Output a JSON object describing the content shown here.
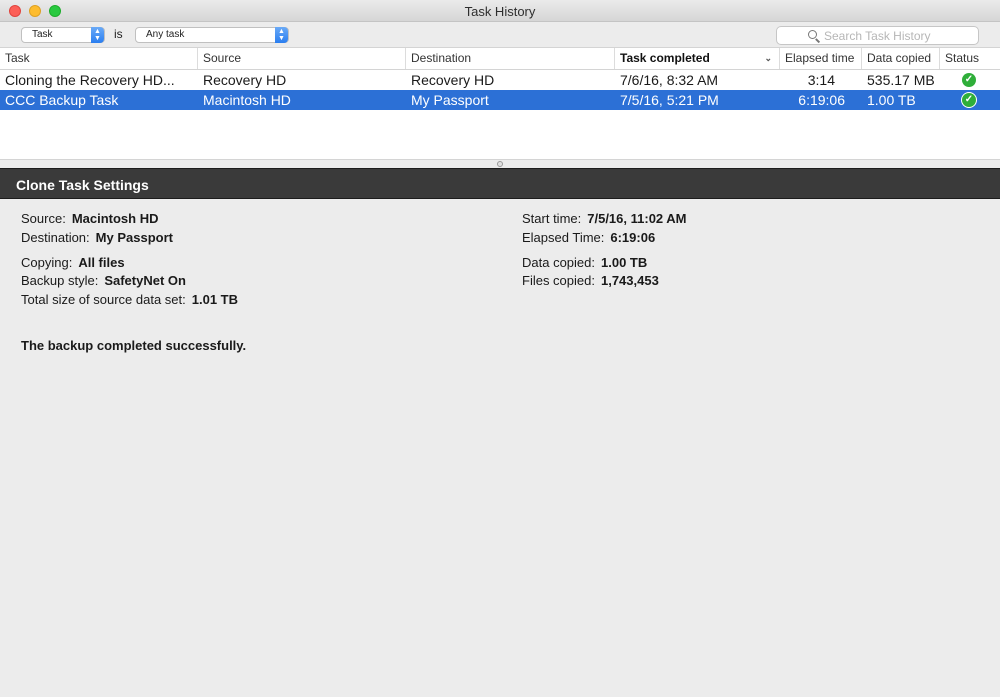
{
  "window": {
    "title": "Task History"
  },
  "filter": {
    "field_value": "Task",
    "operator": "is",
    "match_value": "Any task"
  },
  "search": {
    "placeholder": "Search Task History"
  },
  "table": {
    "columns": [
      "Task",
      "Source",
      "Destination",
      "Task completed",
      "Elapsed time",
      "Data copied",
      "Status"
    ],
    "sorted_column": "Task completed",
    "rows": [
      {
        "task": "Cloning the Recovery HD...",
        "source": "Recovery HD",
        "destination": "Recovery HD",
        "completed": "7/6/16, 8:32 AM",
        "elapsed": "3:14",
        "copied": "535.17 MB",
        "status": "success-check-icon",
        "selected": false
      },
      {
        "task": "CCC Backup Task",
        "source": "Macintosh HD",
        "destination": "My Passport",
        "completed": "7/5/16, 5:21 PM",
        "elapsed": "6:19:06",
        "copied": "1.00 TB",
        "status": "success-check-icon",
        "selected": true
      }
    ]
  },
  "panel": {
    "title": "Clone Task Settings",
    "left": {
      "source_label": "Source:",
      "source_value": "Macintosh HD",
      "destination_label": "Destination:",
      "destination_value": "My Passport",
      "copying_label": "Copying:",
      "copying_value": "All files",
      "backup_style_label": "Backup style:",
      "backup_style_value": "SafetyNet On",
      "total_size_label": "Total size of source data set:",
      "total_size_value": "1.01 TB"
    },
    "right": {
      "start_time_label": "Start time:",
      "start_time_value": "7/5/16, 11:02 AM",
      "elapsed_label": "Elapsed Time:",
      "elapsed_value": "6:19:06",
      "data_copied_label": "Data copied:",
      "data_copied_value": "1.00 TB",
      "files_copied_label": "Files copied:",
      "files_copied_value": "1,743,453"
    },
    "result_message": "The backup completed successfully."
  },
  "colors": {
    "selection": "#2c70d6",
    "panel_header": "#3a3a3a",
    "success": "#2fae3a",
    "close": "#fc5f57",
    "minimize": "#fdbc2e",
    "maximize": "#29c940"
  }
}
